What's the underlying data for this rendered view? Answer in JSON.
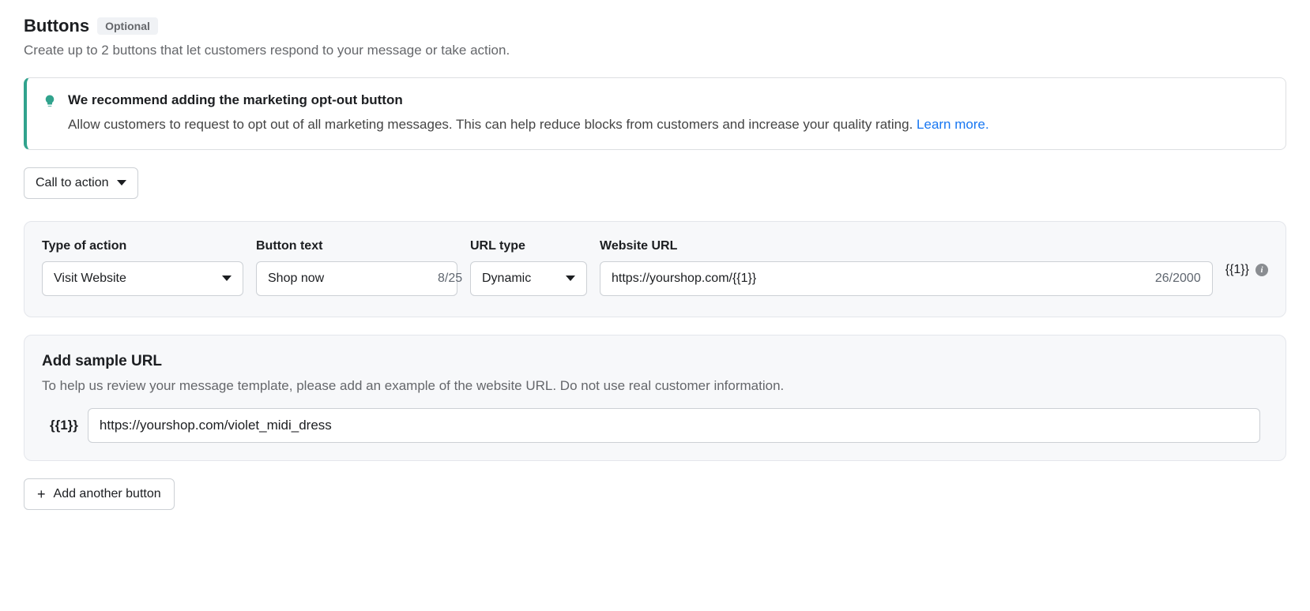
{
  "header": {
    "title": "Buttons",
    "badge": "Optional",
    "description": "Create up to 2 buttons that let customers respond to your message or take action."
  },
  "tip": {
    "title": "We recommend adding the marketing opt-out button",
    "description": "Allow customers to request to opt out of all marketing messages. This can help reduce blocks from customers and increase your quality rating. ",
    "learn_more": "Learn more."
  },
  "button_type_selector": {
    "value": "Call to action"
  },
  "config": {
    "type_of_action": {
      "label": "Type of action",
      "value": "Visit Website"
    },
    "button_text": {
      "label": "Button text",
      "value": "Shop now",
      "counter": "8/25"
    },
    "url_type": {
      "label": "URL type",
      "value": "Dynamic"
    },
    "website_url": {
      "label": "Website URL",
      "value": "https://yourshop.com/{{1}}",
      "counter": "26/2000"
    },
    "variable_chip": "{{1}}"
  },
  "sample": {
    "title": "Add sample URL",
    "description": "To help us review your message template, please add an example of the website URL. Do not use real customer information.",
    "var_label": "{{1}}",
    "value": "https://yourshop.com/violet_midi_dress"
  },
  "add_button": {
    "label": "Add another button"
  }
}
